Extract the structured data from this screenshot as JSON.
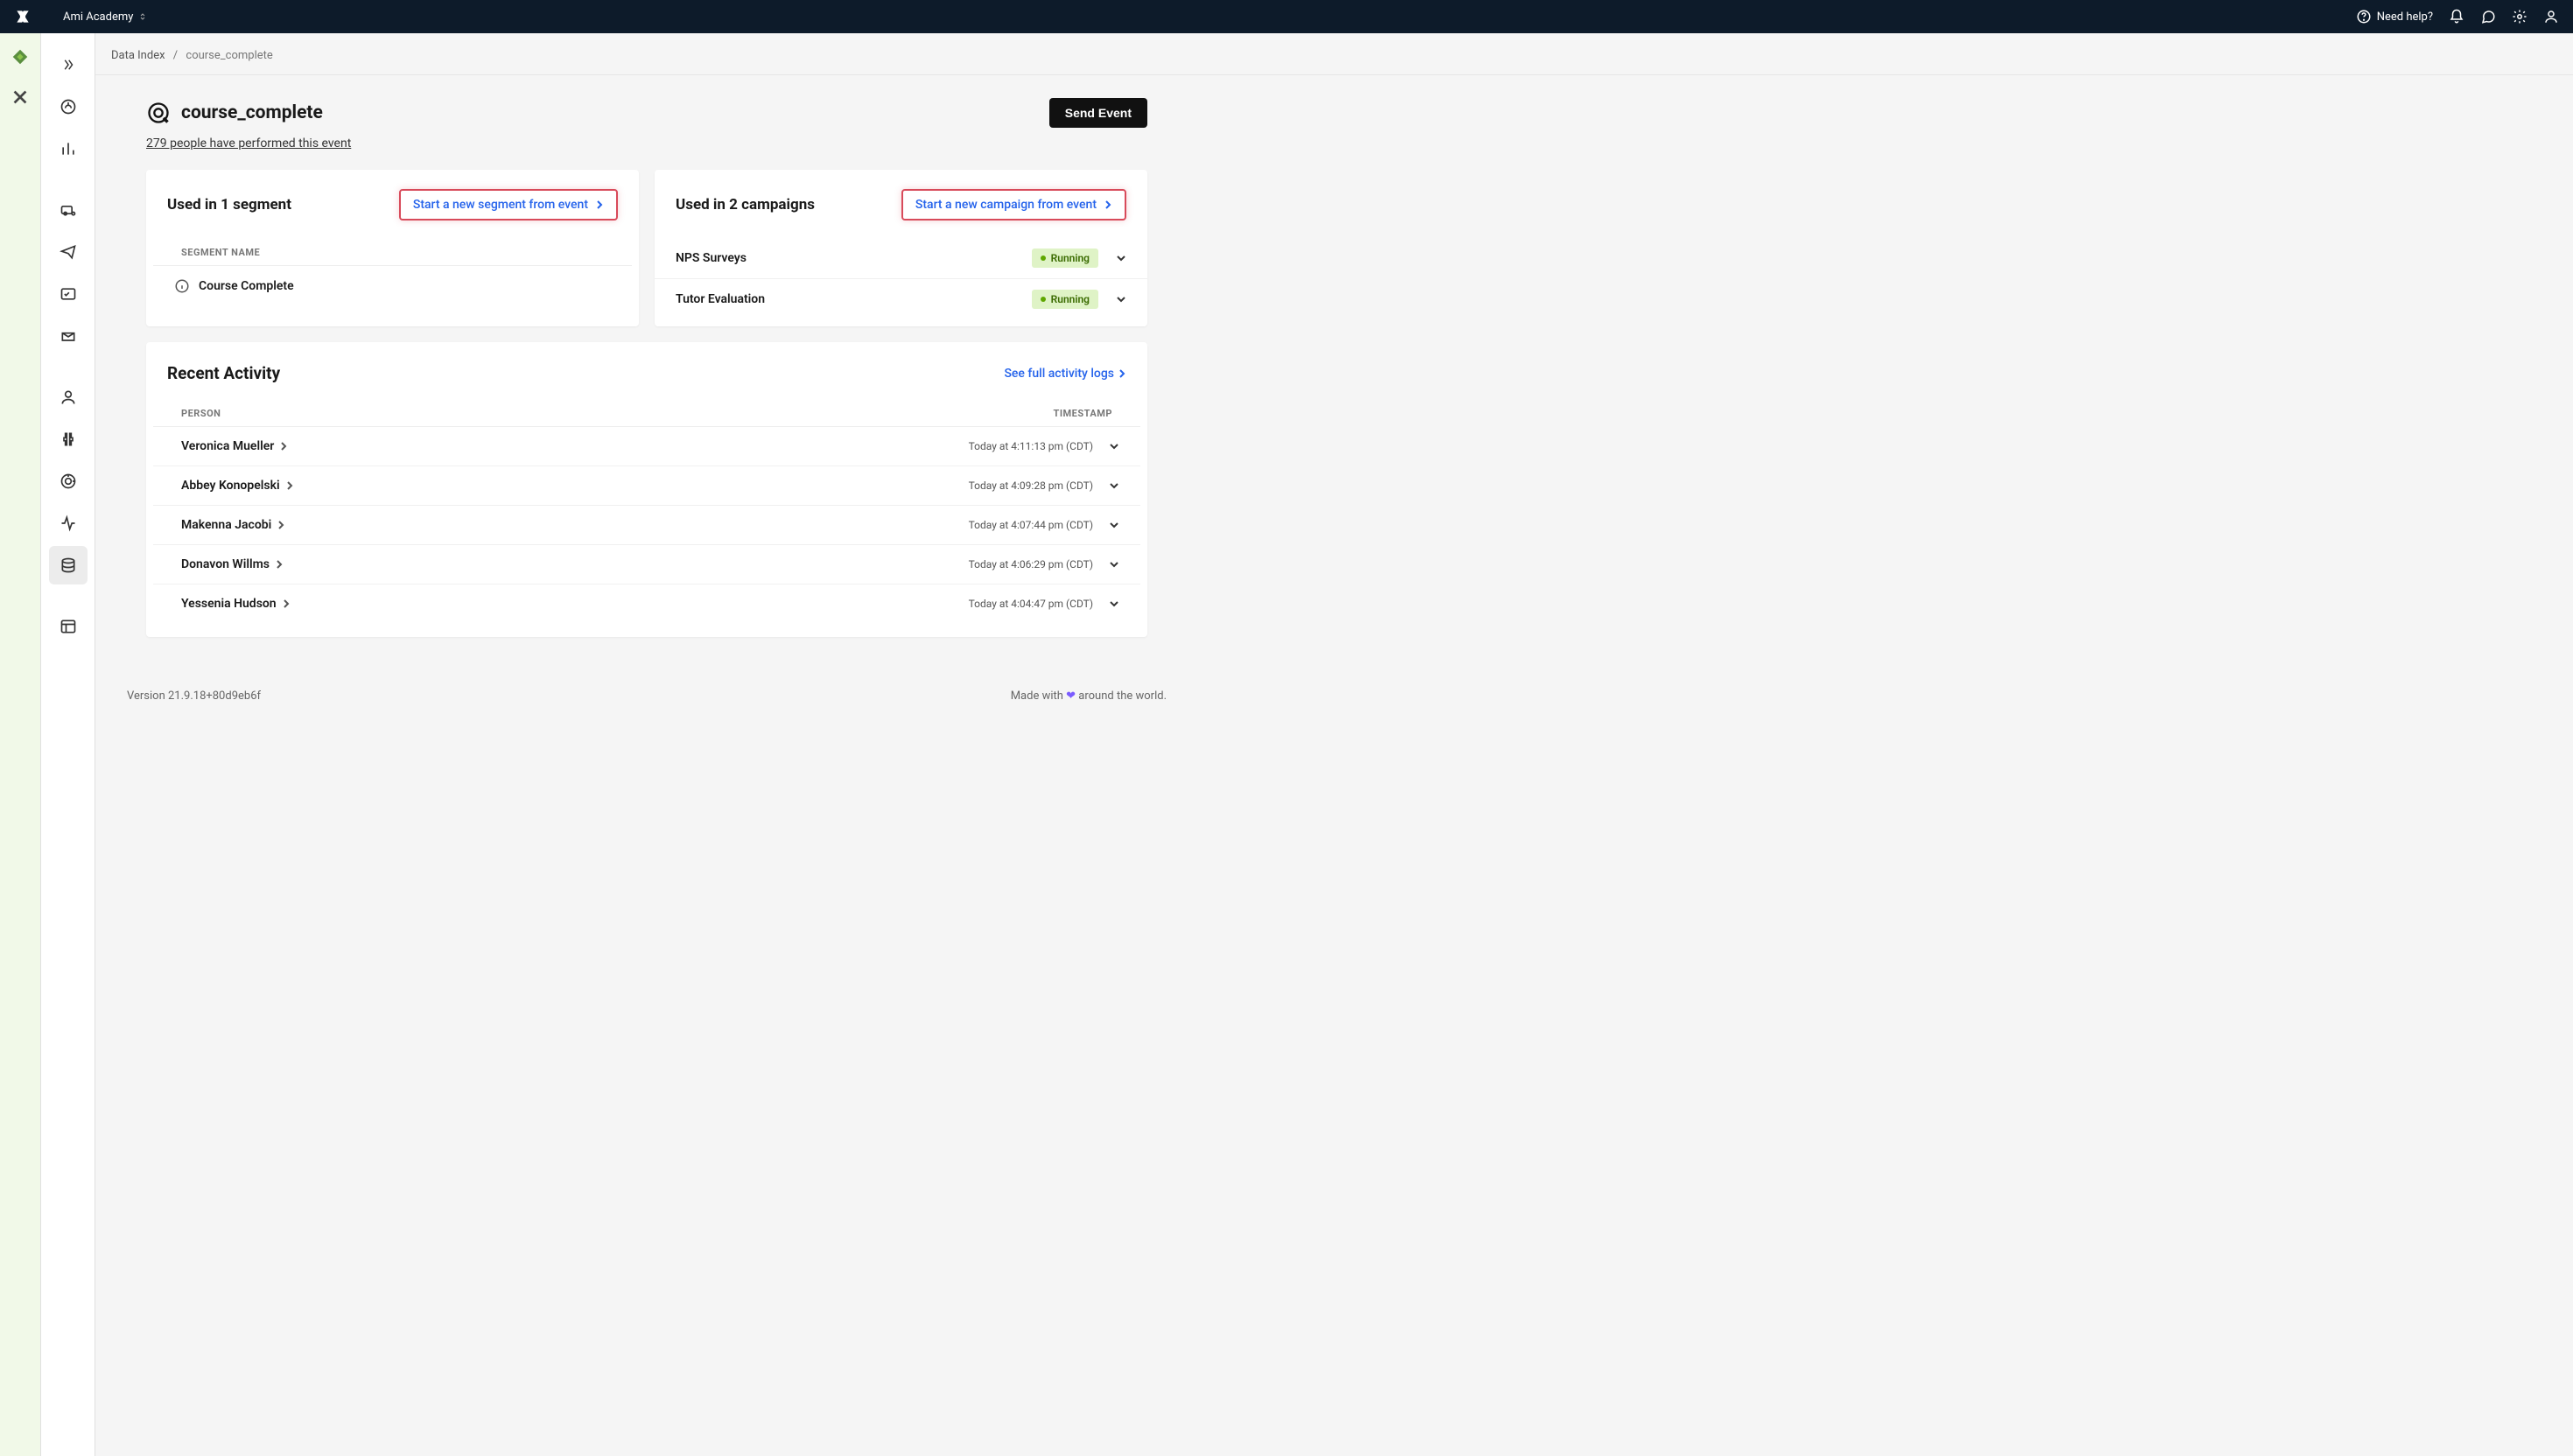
{
  "header": {
    "workspace": "Ami Academy",
    "help_label": "Need help?"
  },
  "breadcrumb": {
    "parent": "Data Index",
    "current": "course_complete"
  },
  "page": {
    "title": "course_complete",
    "people_link": "279 people have performed this event",
    "send_event_label": "Send Event"
  },
  "segments": {
    "heading": "Used in 1 segment",
    "cta": "Start a new segment from event",
    "col_header": "SEGMENT NAME",
    "rows": [
      {
        "name": "Course Complete"
      }
    ]
  },
  "campaigns": {
    "heading": "Used in 2 campaigns",
    "cta": "Start a new campaign from event",
    "rows": [
      {
        "name": "NPS Surveys",
        "status": "Running"
      },
      {
        "name": "Tutor Evaluation",
        "status": "Running"
      }
    ]
  },
  "activity": {
    "heading": "Recent Activity",
    "see_all": "See full activity logs",
    "col_person": "PERSON",
    "col_timestamp": "TIMESTAMP",
    "rows": [
      {
        "name": "Veronica Mueller",
        "ts": "Today at 4:11:13 pm (CDT)"
      },
      {
        "name": "Abbey Konopelski",
        "ts": "Today at 4:09:28 pm (CDT)"
      },
      {
        "name": "Makenna Jacobi",
        "ts": "Today at 4:07:44 pm (CDT)"
      },
      {
        "name": "Donavon Willms",
        "ts": "Today at 4:06:29 pm (CDT)"
      },
      {
        "name": "Yessenia Hudson",
        "ts": "Today at 4:04:47 pm (CDT)"
      }
    ]
  },
  "footer": {
    "version": "Version 21.9.18+80d9eb6f",
    "made_pre": "Made with ",
    "made_post": " around the world."
  }
}
